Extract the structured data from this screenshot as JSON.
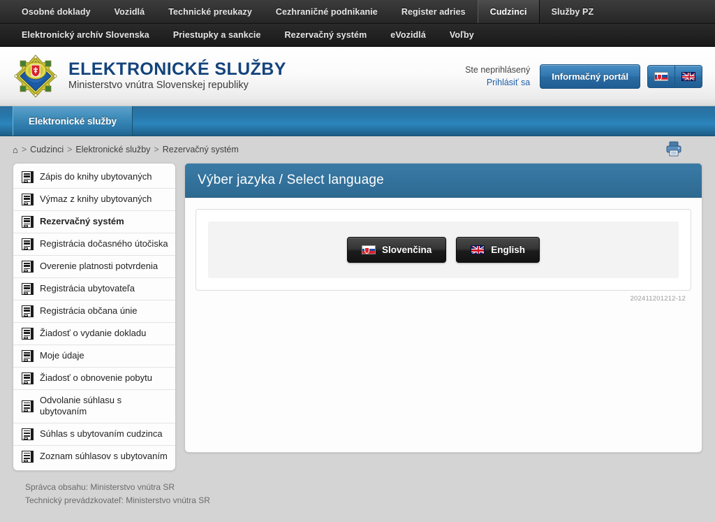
{
  "topnav": {
    "row1": [
      {
        "label": "Osobné doklady",
        "active": false
      },
      {
        "label": "Vozidlá",
        "active": false
      },
      {
        "label": "Technické preukazy",
        "active": false
      },
      {
        "label": "Cezhraničné podnikanie",
        "active": false
      },
      {
        "label": "Register adries",
        "active": false
      },
      {
        "label": "Cudzinci",
        "active": true
      },
      {
        "label": "Služby PZ",
        "active": false
      }
    ],
    "row2": [
      {
        "label": "Elektronický archív Slovenska",
        "active": false
      },
      {
        "label": "Priestupky a sankcie",
        "active": false
      },
      {
        "label": "Rezervačný systém",
        "active": false
      },
      {
        "label": "eVozidlá",
        "active": false
      },
      {
        "label": "Voľby",
        "active": false
      }
    ]
  },
  "header": {
    "title": "ELEKTRONICKÉ SLUŽBY",
    "subtitle": "Ministerstvo vnútra Slovenskej republiky",
    "emblem_icon": "slovak-coat-of-arms-emblem",
    "login_status": "Ste neprihlásený",
    "login_link": "Prihlásiť sa",
    "portal_button": "Informačný portál",
    "lang_sk_icon": "flag-slovakia-icon",
    "lang_en_icon": "flag-united-kingdom-icon"
  },
  "tabstrip": {
    "tabs": [
      {
        "label": "Elektronické služby",
        "active": true
      }
    ]
  },
  "breadcrumb": {
    "home_icon": "home-icon",
    "items": [
      "Cudzinci",
      "Elektronické služby",
      "Rezervačný systém"
    ],
    "separator": ">",
    "print_icon": "printer-icon"
  },
  "sidebar": {
    "items": [
      {
        "label": "Zápis do knihy ubytovaných",
        "current": false
      },
      {
        "label": "Výmaz z knihy ubytovaných",
        "current": false
      },
      {
        "label": "Rezervačný systém",
        "current": true
      },
      {
        "label": "Registrácia dočasného útočiska",
        "current": false
      },
      {
        "label": "Overenie platnosti potvrdenia",
        "current": false
      },
      {
        "label": "Registrácia ubytovateľa",
        "current": false
      },
      {
        "label": "Registrácia občana únie",
        "current": false
      },
      {
        "label": "Žiadosť o vydanie dokladu",
        "current": false
      },
      {
        "label": "Moje údaje",
        "current": false
      },
      {
        "label": "Žiadosť o obnovenie pobytu",
        "current": false
      },
      {
        "label": "Odvolanie súhlasu s ubytovaním",
        "current": false
      },
      {
        "label": "Súhlas s ubytovaním cudzinca",
        "current": false
      },
      {
        "label": "Zoznam súhlasov s ubytovaním",
        "current": false
      }
    ],
    "item_icon": "document-list-icon"
  },
  "main": {
    "panel_title": "Výber jazyka / Select language",
    "buttons": [
      {
        "label": "Slovenčina",
        "icon": "flag-slovakia-icon"
      },
      {
        "label": "English",
        "icon": "flag-united-kingdom-icon"
      }
    ],
    "version": "202411201212-12"
  },
  "footer": {
    "line1": "Správca obsahu: Ministerstvo vnútra SR",
    "line2": "Technický prevádzkovateľ: Ministerstvo vnútra SR"
  },
  "colors": {
    "brand_blue": "#14447c",
    "panel_header": "#356f97",
    "tabstrip": "#2778ab",
    "page_bg": "#d4d4d4",
    "topnav": "#2b2b2b"
  }
}
